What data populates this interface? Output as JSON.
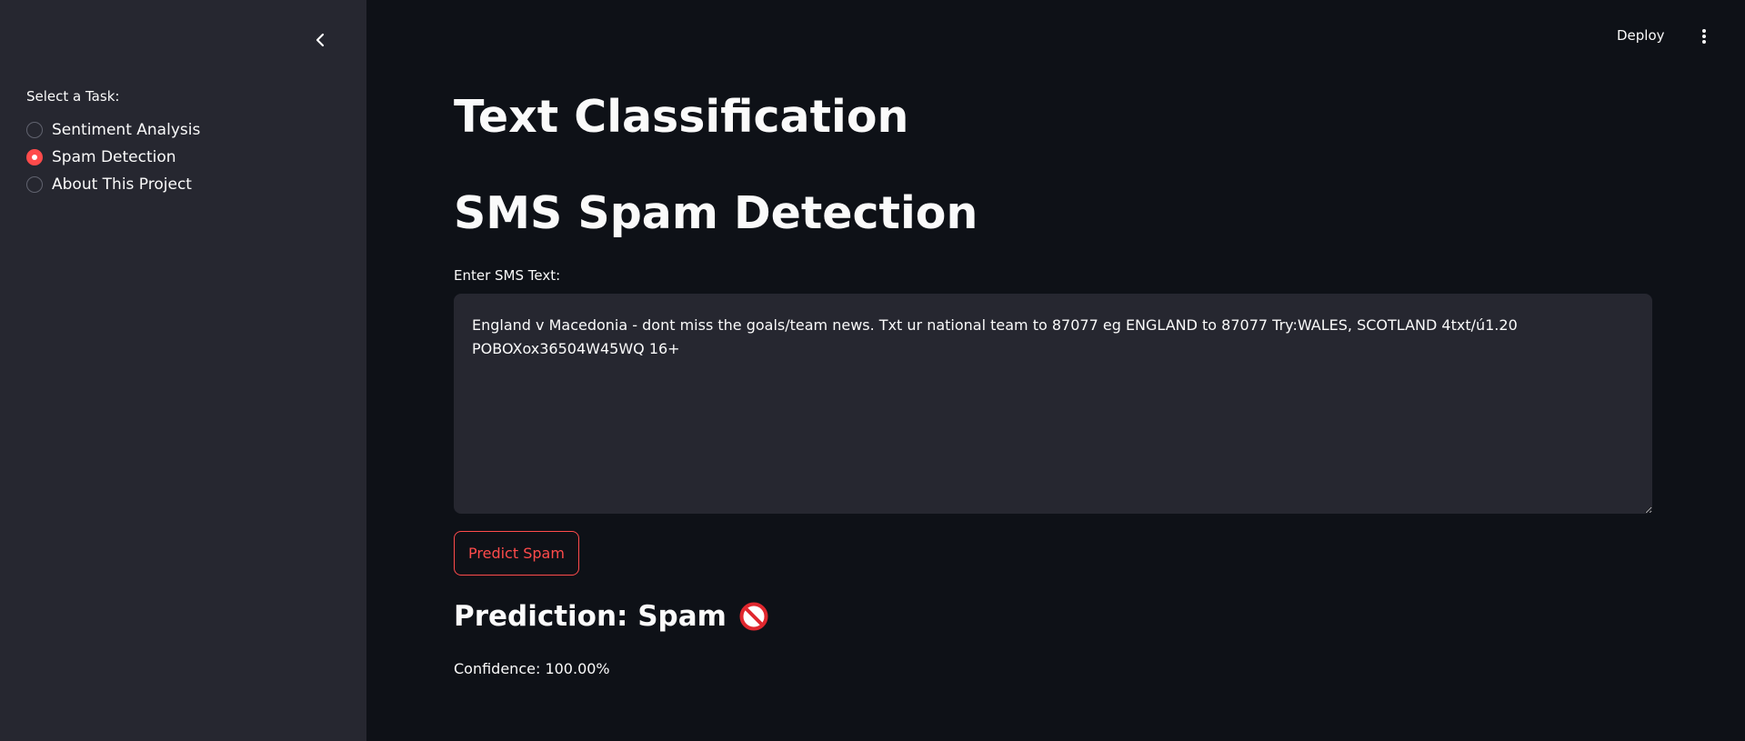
{
  "sidebar": {
    "collapse_icon": "chevron-left-icon",
    "task_label": "Select a Task:",
    "tasks": [
      {
        "label": "Sentiment Analysis",
        "checked": false
      },
      {
        "label": "Spam Detection",
        "checked": true
      },
      {
        "label": "About This Project",
        "checked": false
      }
    ]
  },
  "header": {
    "deploy_label": "Deploy",
    "menu_icon": "vertical-ellipsis-icon"
  },
  "main": {
    "title": "Text Classification",
    "subtitle": "SMS Spam Detection",
    "input_label": "Enter SMS Text:",
    "input_value": "England v Macedonia - dont miss the goals/team news. Txt ur national team to 87077 eg ENGLAND to 87077 Try:WALES, SCOTLAND 4txt/ú1.20 POBOXox36504W45WQ 16+",
    "predict_button": "Predict Spam",
    "prediction_text": "Prediction: Spam",
    "prediction_icon": "no-entry-icon",
    "confidence": "Confidence: 100.00%"
  },
  "colors": {
    "accent": "#ff4b4b",
    "background": "#0e1117",
    "sidebar_background": "#262730",
    "text": "#fafafa"
  }
}
